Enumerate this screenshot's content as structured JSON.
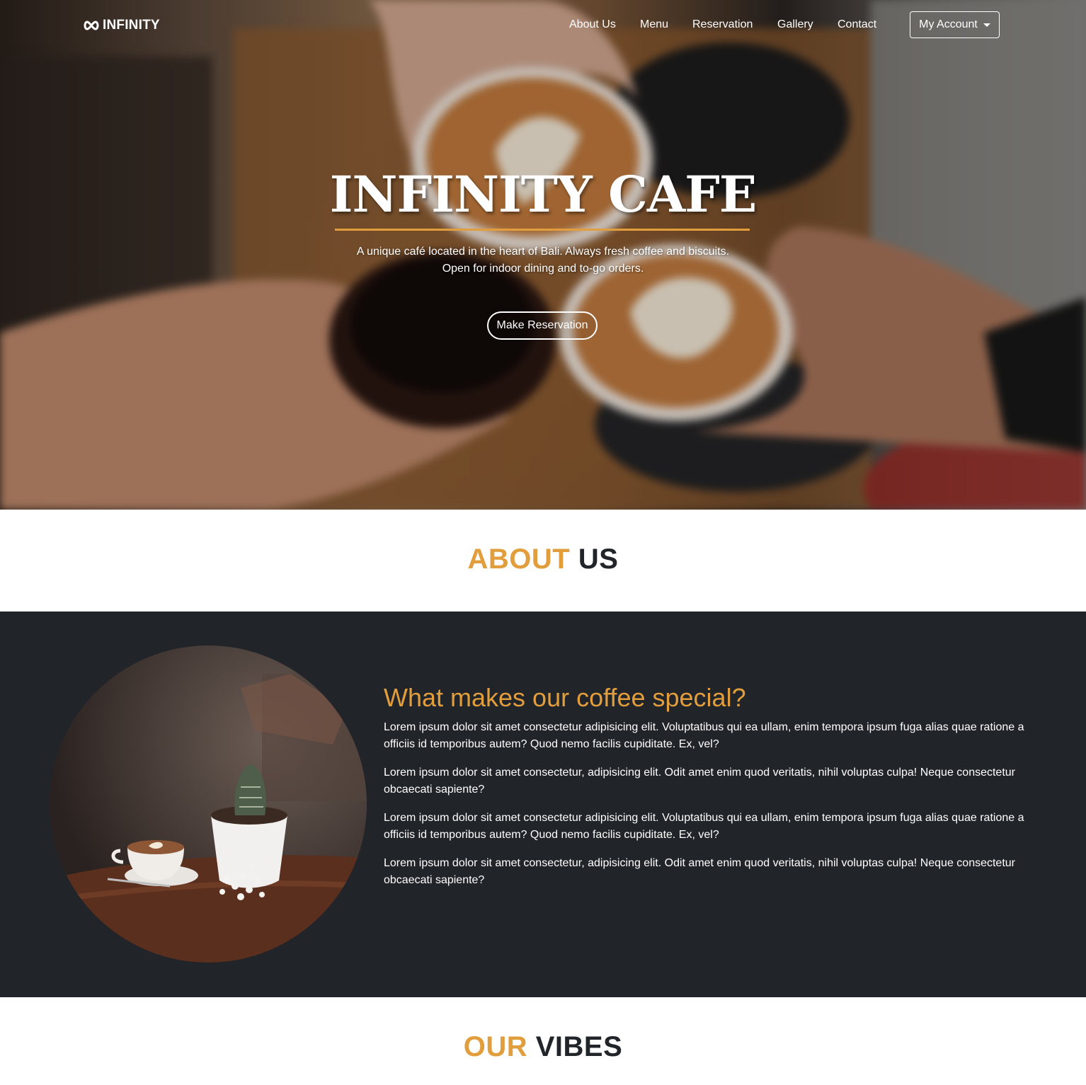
{
  "nav": {
    "brand": "INFINITY",
    "links": [
      "About Us",
      "Menu",
      "Reservation",
      "Gallery",
      "Contact"
    ],
    "account_label": "My Account"
  },
  "hero": {
    "title": "INFINITY CAFE",
    "subtitle_line1": "A unique café located in the heart of Bali. Always fresh coffee and biscuits.",
    "subtitle_line2": "Open for indoor dining and to-go orders.",
    "cta_label": "Make Reservation"
  },
  "about_heading": {
    "accent": "ABOUT",
    "rest": "US"
  },
  "about": {
    "title": "What makes our coffee special?",
    "paragraphs": [
      "Lorem ipsum dolor sit amet consectetur adipisicing elit. Voluptatibus qui ea ullam, enim tempora ipsum fuga alias quae ratione a officiis id temporibus autem? Quod nemo facilis cupiditate. Ex, vel?",
      "Lorem ipsum dolor sit amet consectetur, adipisicing elit. Odit amet enim quod veritatis, nihil voluptas culpa! Neque consectetur obcaecati sapiente?",
      "Lorem ipsum dolor sit amet consectetur adipisicing elit. Voluptatibus qui ea ullam, enim tempora ipsum fuga alias quae ratione a officiis id temporibus autem? Quod nemo facilis cupiditate. Ex, vel?",
      "Lorem ipsum dolor sit amet consectetur, adipisicing elit. Odit amet enim quod veritatis, nihil voluptas culpa! Neque consectetur obcaecati sapiente?"
    ]
  },
  "vibes_heading": {
    "accent": "OUR",
    "rest": "VIBES"
  },
  "colors": {
    "accent": "#e29d3c",
    "dark_band": "#212429",
    "heading": "#212529"
  }
}
